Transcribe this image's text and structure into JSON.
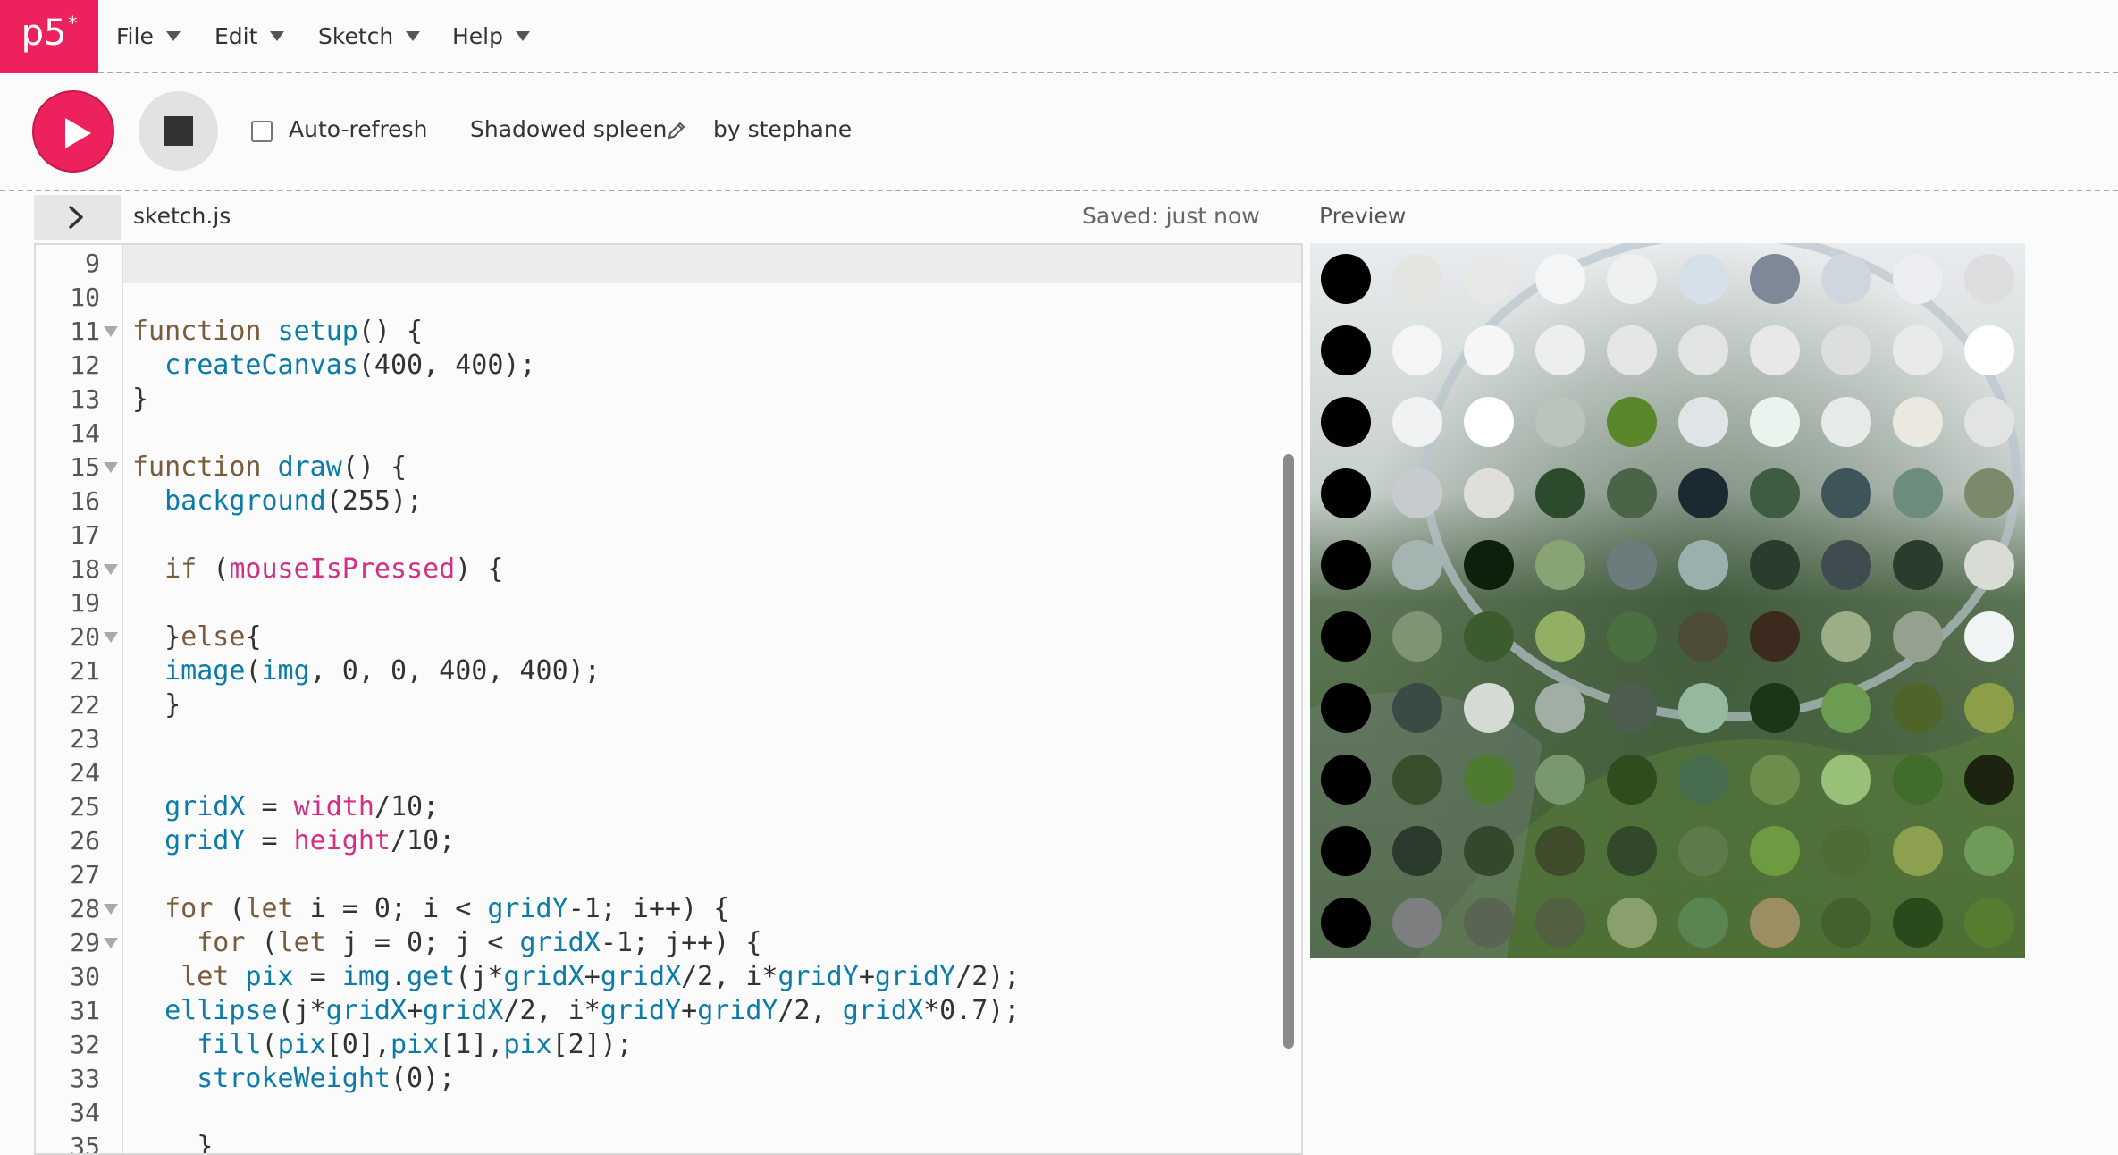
{
  "app": {
    "logo": "p5",
    "logo_mark": "*"
  },
  "menu": {
    "items": [
      {
        "label": "File"
      },
      {
        "label": "Edit"
      },
      {
        "label": "Sketch"
      },
      {
        "label": "Help"
      }
    ]
  },
  "toolbar": {
    "auto_refresh_label": "Auto-refresh",
    "auto_refresh_checked": false,
    "sketch_name": "Shadowed spleen",
    "author": "by stephane"
  },
  "editor": {
    "file_name": "sketch.js",
    "saved_status": "Saved: just now",
    "line_numbers": [
      "9",
      "10",
      "11",
      "12",
      "13",
      "14",
      "15",
      "16",
      "17",
      "18",
      "19",
      "20",
      "21",
      "22",
      "23",
      "24",
      "25",
      "26",
      "27",
      "28",
      "29",
      "30",
      "31",
      "32",
      "33",
      "34",
      "35"
    ],
    "folded_lines": [
      "11",
      "15",
      "18",
      "20",
      "28",
      "29"
    ],
    "lines": [
      "",
      "",
      "function setup() {",
      "  createCanvas(400, 400);",
      "}",
      "",
      "function draw() {",
      "  background(255);",
      "",
      "  if (mouseIsPressed) {",
      "",
      "  }else{",
      "  image(img, 0, 0, 400, 400);",
      "  }",
      "",
      "",
      "  gridX = width/10;",
      "  gridY = height/10;",
      "",
      "  for (let i = 0; i < gridY-1; i++) {",
      "    for (let j = 0; j < gridX-1; j++) {",
      "   let pix = img.get(j*gridX+gridX/2, i*gridY+gridY/2);",
      "  ellipse(j*gridX+gridX/2, i*gridY+gridY/2, gridX*0.7);",
      "    fill(pix[0],pix[1],pix[2]);",
      "    strokeWeight(0);",
      "",
      "    }"
    ]
  },
  "preview": {
    "label": "Preview",
    "dot_colors": [
      [
        "#000000",
        "#e4e4e0",
        "#e8e8e6",
        "#f4f5f6",
        "#eef0f2",
        "#d6e0e8",
        "#7e8896",
        "#d0d6de",
        "#eceef2",
        "#dcdedf"
      ],
      [
        "#000000",
        "#f4f5f4",
        "#f6f6f6",
        "#eceeef",
        "#e4e6e8",
        "#e2e4e4",
        "#e8e8ea",
        "#dcdee0",
        "#e8eaec",
        "#ffffff"
      ],
      [
        "#000000",
        "#f0f2f4",
        "#ffffff",
        "#b8c4bc",
        "#5a862c",
        "#dfe4e6",
        "#eaf4ee",
        "#e6eae8",
        "#ebe8e0",
        "#e2e4e2"
      ],
      [
        "#000000",
        "#c6ccce",
        "#e0ded8",
        "#2c4a2c",
        "#4a6448",
        "#1a2a30",
        "#3e5c40",
        "#3e5458",
        "#6c8c7c",
        "#7c8a6c"
      ],
      [
        "#000000",
        "#a4b4b0",
        "#0c200c",
        "#88a474",
        "#6c7c7c",
        "#9ab0ac",
        "#2a3c2c",
        "#3e4c50",
        "#2a3c2e",
        "#d8dcd4"
      ],
      [
        "#000000",
        "#7e9474",
        "#3c5c2e",
        "#92b064",
        "#4a7040",
        "#4c4c38",
        "#3c2a1e",
        "#9cae88",
        "#96a08e",
        "#f0f4f4"
      ],
      [
        "#000000",
        "#3a4a44",
        "#d6dad4",
        "#a0aea4",
        "#4e5e4e",
        "#96b89c",
        "#1c3418",
        "#6c9c52",
        "#4e6428",
        "#8c9e48"
      ],
      [
        "#000000",
        "#384e2c",
        "#4e7a32",
        "#7a9870",
        "#2e4c1c",
        "#486c4e",
        "#6c8e4a",
        "#98c078",
        "#426c2c",
        "#1c2410"
      ],
      [
        "#000000",
        "#2a3a2c",
        "#34482c",
        "#3e4c2c",
        "#32482a",
        "#5c7a4a",
        "#6e9a42",
        "#4e6c34",
        "#8ca050",
        "#6e9c58"
      ],
      [
        "#000000",
        "#7c7e80",
        "#5a6452",
        "#506040",
        "#8aa06c",
        "#5a8450",
        "#9c8e60",
        "#44602c",
        "#2a4a1c",
        "#567c30"
      ]
    ]
  }
}
